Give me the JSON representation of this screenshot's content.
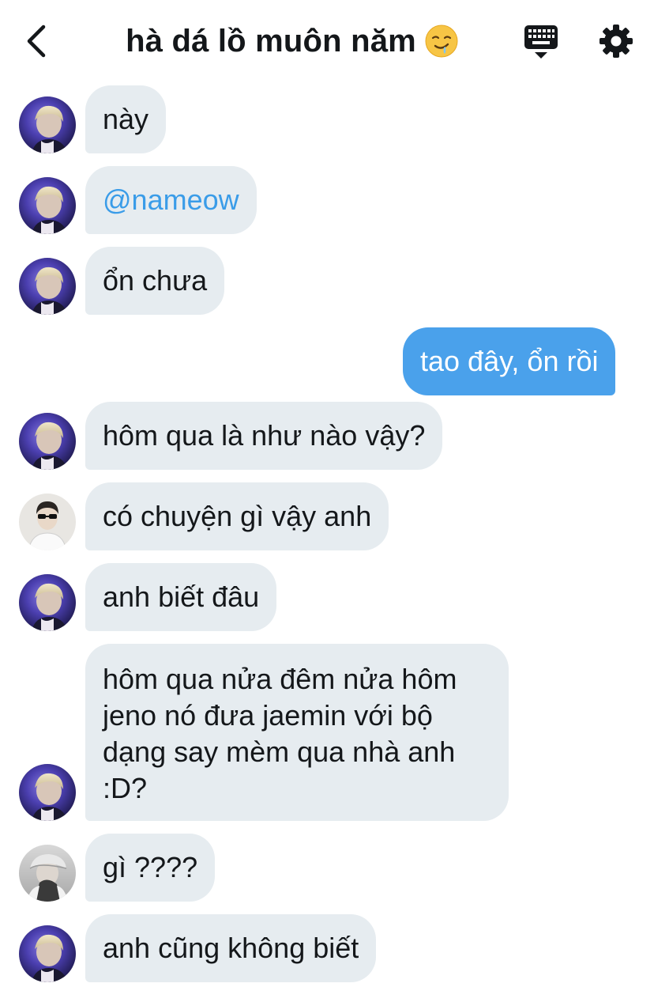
{
  "header": {
    "title": "hà dá lồ muôn năm",
    "title_emoji": "drooling-face-emoji",
    "back_icon": "chevron-left-icon",
    "keyboard_icon": "keyboard-icon",
    "settings_icon": "gear-icon"
  },
  "messages": [
    {
      "sender": "incoming",
      "avatar": "avatar-purple",
      "text": "này"
    },
    {
      "sender": "incoming",
      "avatar": "avatar-purple",
      "text": "@nameow"
    },
    {
      "sender": "incoming",
      "avatar": "avatar-purple",
      "text": "ổn chưa"
    },
    {
      "sender": "outgoing",
      "text": "tao đây, ổn rồi"
    },
    {
      "sender": "incoming",
      "avatar": "avatar-purple",
      "text": "hôm qua là như nào vậy?"
    },
    {
      "sender": "incoming",
      "avatar": "avatar-sunglasses",
      "text": "có chuyện gì vậy anh"
    },
    {
      "sender": "incoming",
      "avatar": "avatar-purple",
      "text": "anh biết đâu"
    },
    {
      "sender": "incoming",
      "avatar": "avatar-purple",
      "text_lines": [
        "hôm qua nửa đêm nửa hôm",
        "jeno nó đưa jaemin với bộ",
        "dạng say mèm qua nhà anh",
        ":D?"
      ]
    },
    {
      "sender": "incoming",
      "avatar": "avatar-cap",
      "text": "gì ????"
    },
    {
      "sender": "incoming",
      "avatar": "avatar-purple",
      "text": "anh cũng không biết"
    }
  ],
  "colors": {
    "incoming_bubble": "#e6ecf0",
    "outgoing_bubble": "#4aa1eb",
    "mention": "#3a9ce8",
    "text": "#14171a"
  }
}
